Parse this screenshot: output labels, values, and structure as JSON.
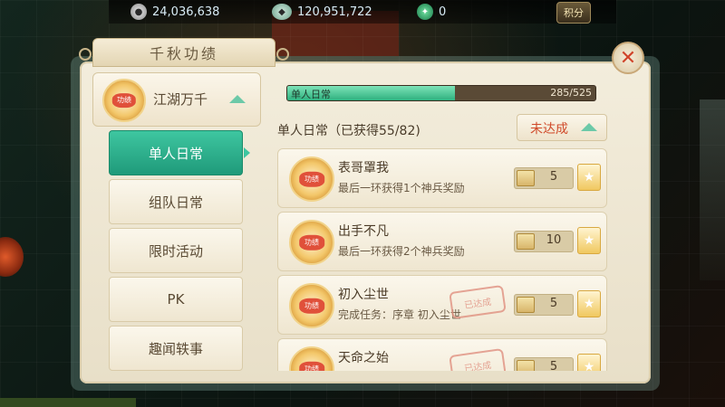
{
  "topbar": {
    "coin": {
      "icon": "coin-icon",
      "value": "24,036,638"
    },
    "silver": {
      "icon": "silver-ingot-icon",
      "value": "120,951,722"
    },
    "jade": {
      "icon": "jade-icon",
      "value": "0"
    },
    "points_label": "积分"
  },
  "panel": {
    "title": "千秋功绩",
    "category": {
      "name": "江湖万千",
      "medal_text": "功绩"
    },
    "subtabs": [
      {
        "label": "单人日常",
        "active": true
      },
      {
        "label": "组队日常",
        "active": false
      },
      {
        "label": "限时活动",
        "active": false
      },
      {
        "label": "PK",
        "active": false
      },
      {
        "label": "趣闻轶事",
        "active": false
      }
    ],
    "progress": {
      "label": "单人日常",
      "count": "285/525",
      "fraction": 0.543
    },
    "section_title": "单人日常（已获得55/82)",
    "status_button": "未达成",
    "items": [
      {
        "name": "表哥罩我",
        "desc": "最后一环获得1个神兵奖励",
        "reward": "5",
        "completed": false
      },
      {
        "name": "出手不凡",
        "desc": "最后一环获得2个神兵奖励",
        "reward": "10",
        "completed": false
      },
      {
        "name": "初入尘世",
        "desc": "完成任务：序章 初入尘世",
        "reward": "5",
        "completed": true
      },
      {
        "name": "天命之始",
        "desc": "",
        "reward": "5",
        "completed": true
      }
    ],
    "stamp_text": "已达成",
    "medal_text": "功绩"
  },
  "colors": {
    "accent": "#2eb07e",
    "status_red": "#d04a2a",
    "panel_bg": "#f3eddc"
  }
}
